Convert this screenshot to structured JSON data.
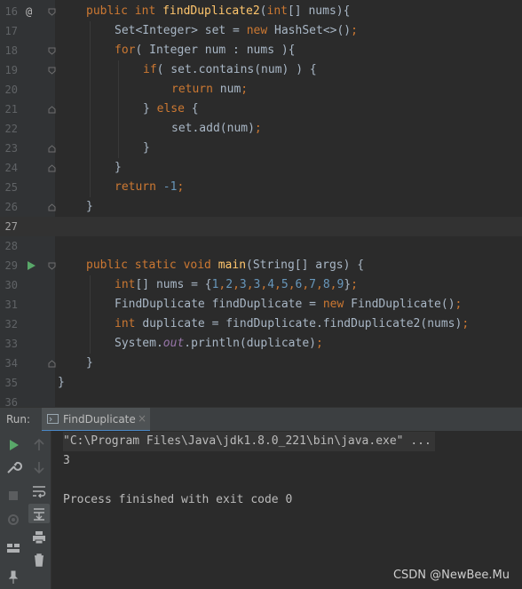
{
  "editor": {
    "current_line": "27",
    "lines": [
      {
        "num": "16",
        "marker": "@"
      },
      {
        "num": "17"
      },
      {
        "num": "18"
      },
      {
        "num": "19"
      },
      {
        "num": "20"
      },
      {
        "num": "21"
      },
      {
        "num": "22"
      },
      {
        "num": "23"
      },
      {
        "num": "24"
      },
      {
        "num": "25"
      },
      {
        "num": "26"
      },
      {
        "num": "27"
      },
      {
        "num": "28"
      },
      {
        "num": "29",
        "marker": "run-gutter-icon"
      },
      {
        "num": "30"
      },
      {
        "num": "31"
      },
      {
        "num": "32"
      },
      {
        "num": "33"
      },
      {
        "num": "34"
      },
      {
        "num": "35"
      },
      {
        "num": "36"
      }
    ],
    "code": {
      "l16": {
        "kw1": "public int ",
        "fn": "findDuplicate2",
        "a": "(",
        "kw2": "int",
        "b": "[] nums){"
      },
      "l17": {
        "a": "Set<Integer> set = ",
        "kw": "new ",
        "b": "HashSet<>()",
        "semi": ";"
      },
      "l18": {
        "kw": "for",
        "a": "( Integer num : nums ){"
      },
      "l19": {
        "kw": "if",
        "a": "( set.contains(num) ) {"
      },
      "l20": {
        "kw": "return ",
        "a": "num",
        "semi": ";"
      },
      "l21": {
        "a": "} ",
        "kw": "else ",
        "b": "{"
      },
      "l22": {
        "a": "set.add(num)",
        "semi": ";"
      },
      "l23": {
        "a": "}"
      },
      "l24": {
        "a": "}"
      },
      "l25": {
        "kw": "return ",
        "num": "-1",
        "semi": ";"
      },
      "l26": {
        "a": "}"
      },
      "l29": {
        "kw": "public static void ",
        "fn": "main",
        "a": "(String[] args) {"
      },
      "l30": {
        "kw": "int",
        "a": "[] nums = {",
        "n1": "1",
        "n2": "2",
        "n3": "3",
        "n4": "3",
        "n5": "4",
        "n6": "5",
        "n7": "6",
        "n8": "7",
        "n9": "8",
        "n10": "9",
        "b": "}",
        "semi": ";",
        "comma": ","
      },
      "l31": {
        "a": "FindDuplicate findDuplicate = ",
        "kw": "new ",
        "b": "FindDuplicate()",
        "semi": ";"
      },
      "l32": {
        "kw": "int ",
        "a": "duplicate = findDuplicate.findDuplicate2(nums)",
        "semi": ";"
      },
      "l33": {
        "a": "System.",
        "it": "out",
        "b": ".println(duplicate)",
        "semi": ";"
      },
      "l34": {
        "a": "}"
      },
      "l35": {
        "a": "}"
      }
    }
  },
  "run_panel": {
    "label": "Run:",
    "tab_label": "FindDuplicate",
    "tab_close": "×",
    "console_lines": [
      "\"C:\\Program Files\\Java\\jdk1.8.0_221\\bin\\java.exe\" ...",
      "3",
      "",
      "Process finished with exit code 0"
    ]
  },
  "watermark": "CSDN @NewBee.Mu",
  "colors": {
    "keyword": "#cc7832",
    "function": "#ffc66d",
    "number": "#6897bb",
    "field_italic": "#9876aa",
    "text": "#a9b7c6",
    "run_green": "#59a869"
  }
}
